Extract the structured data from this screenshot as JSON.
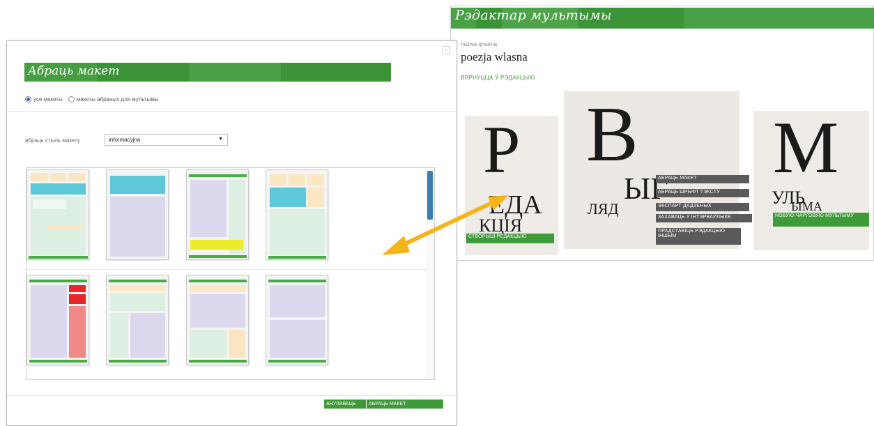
{
  "editor": {
    "title": "Рэдактар мультымы",
    "field_label": "nazwa qmama",
    "field_value": "poezja wlasna",
    "back_link": "ВЯРНУЦЦА Ў РЭДАКЦЫЮ",
    "card_redakcia": {
      "letter": "Р",
      "line1": "ЕДА",
      "line2": "КЦІЯ",
      "button": "СТВОРЫЦІ РЕДАКЦЫЮ"
    },
    "card_vyhlad": {
      "letter": "В",
      "line1": "ЫГ",
      "line2": "ЛЯД",
      "actions": [
        "АБРАЦЬ МАКЕТ",
        "АБРАЦЬ ШРЫФТ ТЭКСТУ",
        "ЭКСПАРТ ДАДЗЕНЫХ",
        "ЗАХАВАЦЬ У ІНТЭРВАЙЧЫКЕ",
        "ПРАДСТАВІЦЬ РЭДАКЦЫЮ ІНШЫМ"
      ]
    },
    "card_multyma": {
      "letter": "М",
      "line1": "УЛЬ",
      "line2": "ЫМА",
      "button": "НОВУЮ ЧАРГОВУЮ МУЛЬТЫМУ"
    }
  },
  "modal": {
    "close_label": "×",
    "title": "Абраць макет",
    "radio_all": "усе макеты",
    "radio_selected": "макеты абраных для мультымы",
    "style_label": "абраць стыль макету",
    "style_value": "informacyjna",
    "cancel_button": "АНУЛЯВАЦЬ",
    "select_button": "АБРАЦЬ МАКЕТ"
  },
  "colors": {
    "brand_green": "#3f9a3a",
    "accent_arrow": "#f4b41a",
    "scroll_blue": "#3a7fb0"
  }
}
